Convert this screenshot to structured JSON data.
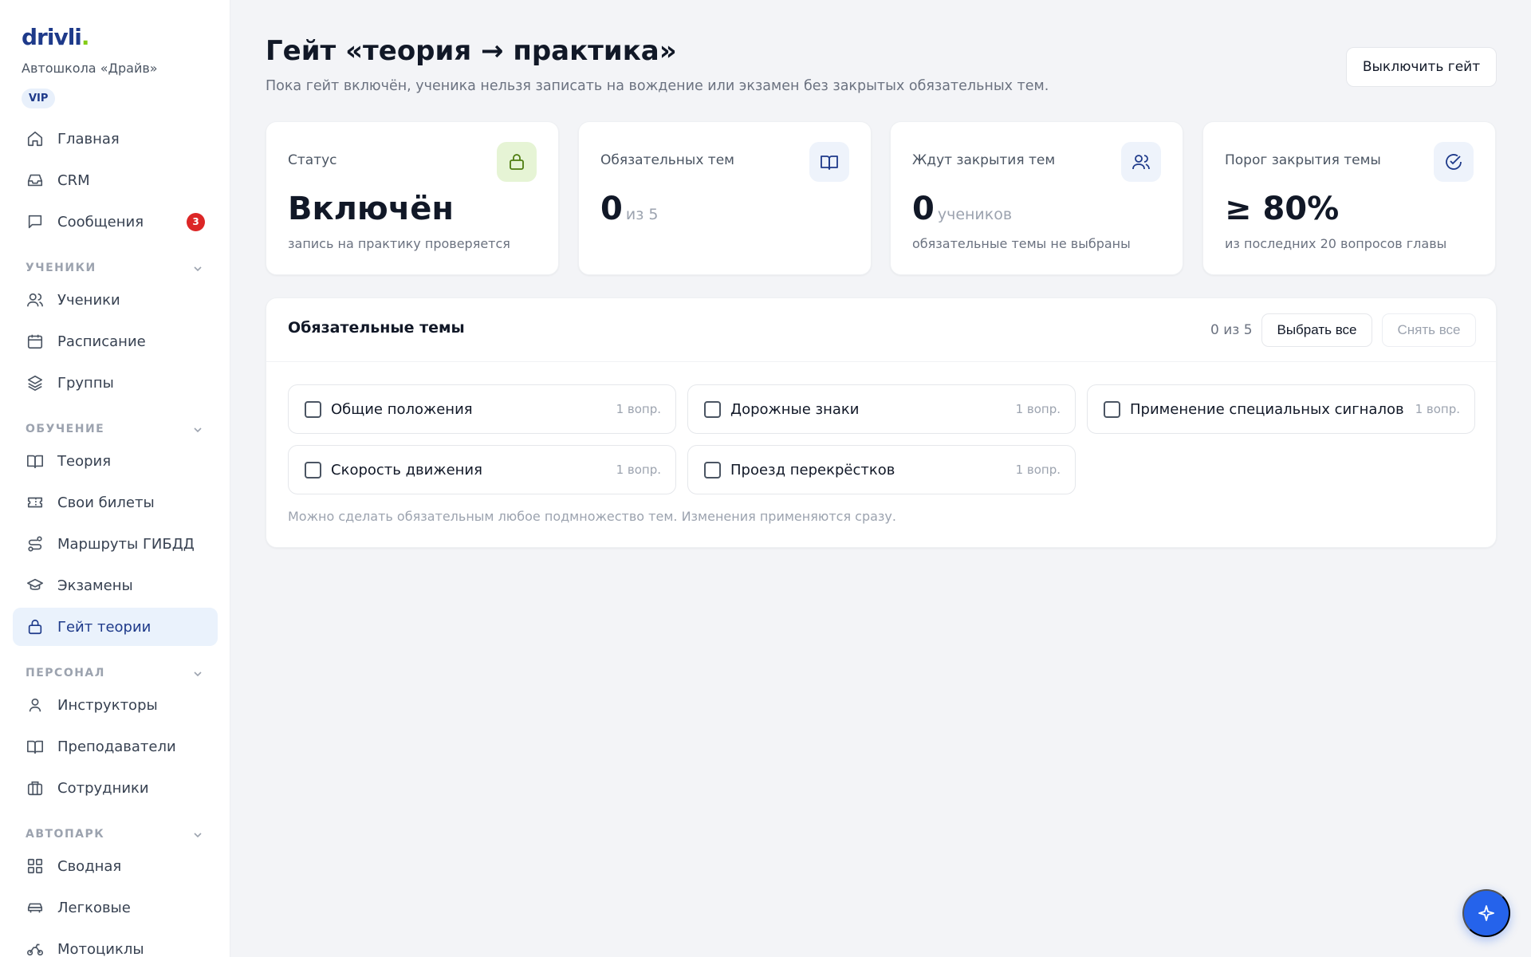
{
  "brand": {
    "logo_text": "drivli",
    "logo_dot": ".",
    "school": "Автошкола «Драйв»",
    "plan_badge": "VIP"
  },
  "nav": {
    "home": "Главная",
    "crm": "CRM",
    "messages": "Сообщения",
    "messages_badge": "3",
    "section_students": "УЧЕНИКИ",
    "students": "Ученики",
    "schedule": "Расписание",
    "groups": "Группы",
    "section_learning": "ОБУЧЕНИЕ",
    "theory": "Теория",
    "tickets": "Свои билеты",
    "routes": "Маршруты ГИБДД",
    "exams": "Экзамены",
    "gate": "Гейт теории",
    "section_staff": "ПЕРСОНАЛ",
    "instructors": "Инструкторы",
    "teachers": "Преподаватели",
    "employees": "Сотрудники",
    "section_fleet": "АВТОПАРК",
    "fleet_summary": "Сводная",
    "cars": "Легковые",
    "motorcycles": "Мотоциклы"
  },
  "header": {
    "title": "Гейт «теория → практика»",
    "subtitle": "Пока гейт включён, ученика нельзя записать на вождение или экзамен без закрытых обязательных тем.",
    "disable_button": "Выключить гейт"
  },
  "stats": [
    {
      "label": "Статус",
      "value": "Включён",
      "unit": "",
      "note": "запись на практику проверяется",
      "icon": "lock-icon",
      "icon_bg": "#e6f4d5",
      "icon_color": "#4d7c0f"
    },
    {
      "label": "Обязательных тем",
      "value": "0",
      "unit": "из 5",
      "note": "",
      "icon": "book-icon",
      "icon_bg": "#eef3fb",
      "icon_color": "#1e3a8a"
    },
    {
      "label": "Ждут закрытия тем",
      "value": "0",
      "unit": "учеников",
      "note": "обязательные темы не выбраны",
      "icon": "users-icon",
      "icon_bg": "#eef3fb",
      "icon_color": "#1e3a8a"
    },
    {
      "label": "Порог закрытия темы",
      "value": "≥ 80%",
      "unit": "",
      "note": "из последних 20 вопросов главы",
      "icon": "check-circle-icon",
      "icon_bg": "#eef3fb",
      "icon_color": "#1e3a8a"
    }
  ],
  "topics": {
    "title": "Обязательные темы",
    "count": "0 из 5",
    "select_all": "Выбрать все",
    "clear_all": "Снять все",
    "items": [
      {
        "name": "Общие положения",
        "questions": "1 вопр.",
        "checked": false
      },
      {
        "name": "Дорожные знаки",
        "questions": "1 вопр.",
        "checked": false
      },
      {
        "name": "Применение специальных сигналов",
        "questions": "1 вопр.",
        "checked": false
      },
      {
        "name": "Скорость движения",
        "questions": "1 вопр.",
        "checked": false
      },
      {
        "name": "Проезд перекрёстков",
        "questions": "1 вопр.",
        "checked": false
      }
    ],
    "footnote": "Можно сделать обязательным любое подмножество тем. Изменения применяются сразу."
  },
  "colors": {
    "accent": "#2563eb",
    "brand_navy": "#1e3a8a",
    "brand_green": "#84cc16",
    "badge_red": "#dc2626"
  },
  "fab": {
    "icon": "sparkle-icon"
  }
}
